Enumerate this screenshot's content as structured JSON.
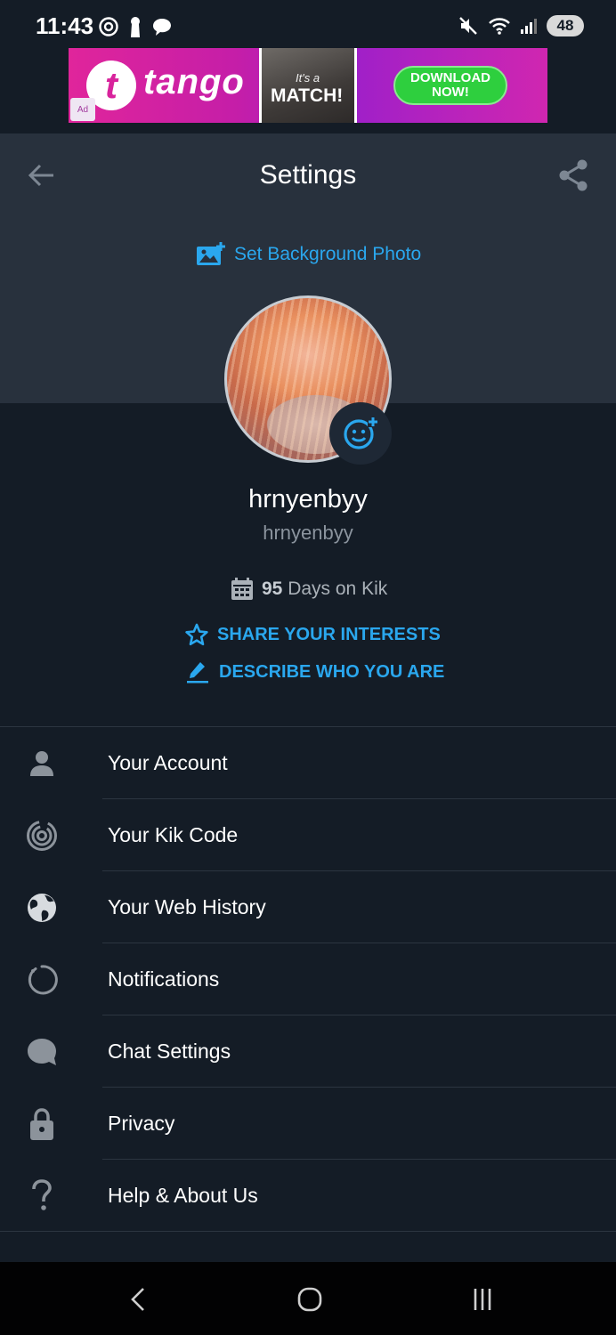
{
  "status_bar": {
    "time": "11:43",
    "left_icons": [
      "threads-icon",
      "keyhole-icon",
      "chat-bubble-icon"
    ],
    "right_icons": [
      "mute-icon",
      "wifi-icon",
      "signal-icon"
    ],
    "battery": "48"
  },
  "ad": {
    "brand": "tango",
    "logo_letter": "t",
    "badge": "Ad",
    "photo_small": "It's a",
    "photo_big": "MATCH!",
    "cta_line1": "DOWNLOAD",
    "cta_line2": "NOW!",
    "colors": {
      "pink": "#e0259b",
      "green": "#2ecf3e"
    }
  },
  "header": {
    "title": "Settings",
    "back_icon": "arrow-left-icon",
    "share_icon": "share-icon",
    "set_background_label": "Set Background Photo"
  },
  "profile": {
    "display_name": "hrnyenbyy",
    "username": "hrnyenbyy",
    "days_count": "95",
    "days_suffix": "Days on Kik",
    "share_interests": "SHARE YOUR INTERESTS",
    "describe": "DESCRIBE WHO YOU ARE"
  },
  "menu": {
    "items": [
      {
        "label": "Your Account",
        "icon": "person-icon"
      },
      {
        "label": "Your Kik Code",
        "icon": "kik-code-icon"
      },
      {
        "label": "Your Web History",
        "icon": "globe-icon"
      },
      {
        "label": "Notifications",
        "icon": "notification-ring-icon"
      },
      {
        "label": "Chat Settings",
        "icon": "chat-bubble-icon"
      },
      {
        "label": "Privacy",
        "icon": "lock-icon"
      },
      {
        "label": "Help & About Us",
        "icon": "question-icon"
      }
    ]
  },
  "nav": {
    "back": "nav-back-icon",
    "home": "nav-home-icon",
    "recents": "nav-recents-icon"
  },
  "colors": {
    "accent": "#2aa7ee",
    "background": "#141c26",
    "header": "#28313d"
  }
}
